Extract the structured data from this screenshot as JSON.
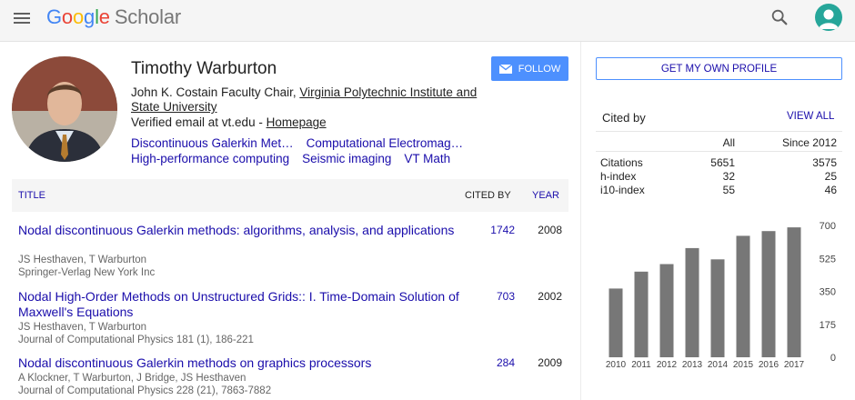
{
  "header": {
    "logo_google": [
      "G",
      "o",
      "o",
      "g",
      "l",
      "e"
    ],
    "logo_scholar": "Scholar"
  },
  "profile": {
    "name": "Timothy Warburton",
    "affiliation_prefix": "John K. Costain Faculty Chair, ",
    "affiliation_link": "Virginia Polytechnic Institute and State University",
    "email_text": "Verified email at vt.edu - ",
    "homepage_label": "Homepage",
    "interests": [
      "Discontinuous Galerkin Met…",
      "Computational Electromag…",
      "High-performance computing",
      "Seismic imaging",
      "VT Math"
    ],
    "follow_label": "FOLLOW"
  },
  "table": {
    "title_header": "TITLE",
    "cited_header": "CITED BY",
    "year_header": "YEAR",
    "rows": [
      {
        "title": "Nodal discontinuous Galerkin methods: algorithms, analysis, and applications",
        "authors": "JS Hesthaven, T Warburton",
        "venue": "Springer-Verlag New York Inc",
        "cited_by": "1742",
        "year": "2008"
      },
      {
        "title": "Nodal High-Order Methods on Unstructured Grids:: I. Time-Domain Solution of Maxwell's Equations",
        "authors": "JS Hesthaven, T Warburton",
        "venue": "Journal of Computational Physics 181 (1), 186-221",
        "cited_by": "703",
        "year": "2002"
      },
      {
        "title": "Nodal discontinuous Galerkin methods on graphics processors",
        "authors": "A Klockner, T Warburton, J Bridge, JS Hesthaven",
        "venue": "Journal of Computational Physics 228 (21), 7863-7882",
        "cited_by": "284",
        "year": "2009"
      }
    ]
  },
  "sidebar": {
    "own_profile_label": "GET MY OWN PROFILE",
    "cited_by_label": "Cited by",
    "view_all_label": "VIEW ALL",
    "col_all": "All",
    "col_since": "Since 2012",
    "stats": [
      {
        "label": "Citations",
        "all": "5651",
        "since": "3575"
      },
      {
        "label": "h-index",
        "all": "32",
        "since": "25"
      },
      {
        "label": "i10-index",
        "all": "55",
        "since": "46"
      }
    ]
  },
  "colors": {
    "bar": "#777777",
    "link": "#1a0dab",
    "follow": "#4d90fe",
    "avatar": "#26a69a"
  },
  "chart_data": {
    "type": "bar",
    "categories": [
      "2010",
      "2011",
      "2012",
      "2013",
      "2014",
      "2015",
      "2016",
      "2017"
    ],
    "values": [
      365,
      455,
      495,
      580,
      520,
      645,
      670,
      690
    ],
    "ylim": [
      0,
      700
    ],
    "yticks": [
      "0",
      "175",
      "350",
      "525",
      "700"
    ],
    "grid": false
  }
}
